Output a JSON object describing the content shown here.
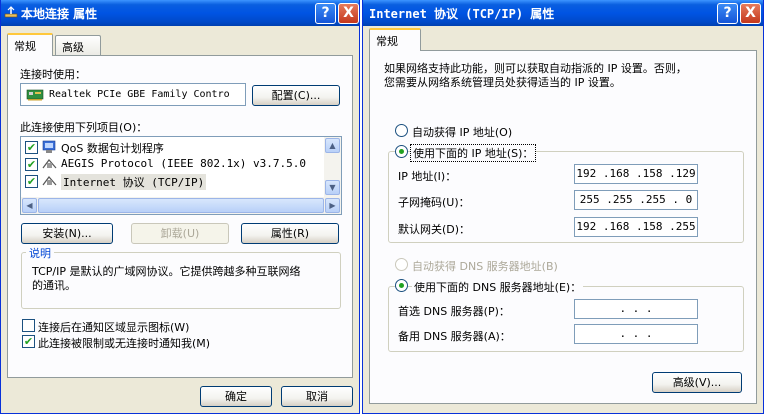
{
  "left_window": {
    "title": "本地连接 属性",
    "help_btn": "?",
    "close_btn": "X",
    "tabs": [
      "常规",
      "高级"
    ],
    "connect_using_label": "连接时使用：",
    "adapter_name": "Realtek PCIe GBE Family Contro",
    "configure_btn": "配置(C)...",
    "items_label": "此连接使用下列项目(O)：",
    "items": [
      {
        "label": "QoS 数据包计划程序",
        "checked": true
      },
      {
        "label": "AEGIS Protocol (IEEE 802.1x) v3.7.5.0",
        "checked": true
      },
      {
        "label": "Internet 协议 (TCP/IP)",
        "checked": true
      }
    ],
    "install_btn": "安装(N)...",
    "uninstall_btn": "卸载(U)",
    "properties_btn": "属性(R)",
    "description_title": "说明",
    "description_text_1": "TCP/IP 是默认的广域网协议。它提供跨越多种互联网络",
    "description_text_2": "的通讯。",
    "show_icon_label": "连接后在通知区域显示图标(W)",
    "show_icon_checked": false,
    "notify_label": "此连接被限制或无连接时通知我(M)",
    "notify_checked": true,
    "ok_btn": "确定",
    "cancel_btn": "取消"
  },
  "right_window": {
    "title": "Internet 协议 (TCP/IP) 属性",
    "help_btn": "?",
    "close_btn": "X",
    "tab": "常规",
    "intro_1": "如果网络支持此功能，则可以获取自动指派的 IP 设置。否则，",
    "intro_2": "您需要从网络系统管理员处获得适当的 IP 设置。",
    "auto_ip_label": "自动获得 IP 地址(O)",
    "manual_ip_label": "使用下面的 IP 地址(S)：",
    "ip_label": "IP 地址(I)：",
    "ip_value": "192 .168 .158 .129",
    "mask_label": "子网掩码(U)：",
    "mask_value": "255 .255 .255 . 0",
    "gateway_label": "默认网关(D)：",
    "gateway_value": "192 .168 .158 .255",
    "auto_dns_label": "自动获得 DNS 服务器地址(B)",
    "manual_dns_label": "使用下面的 DNS 服务器地址(E)：",
    "pref_dns_label": "首选 DNS 服务器(P)：",
    "pref_dns_value": ".     .     .",
    "alt_dns_label": "备用 DNS 服务器(A)：",
    "alt_dns_value": ".     .     .",
    "advanced_btn": "高级(V)..."
  }
}
